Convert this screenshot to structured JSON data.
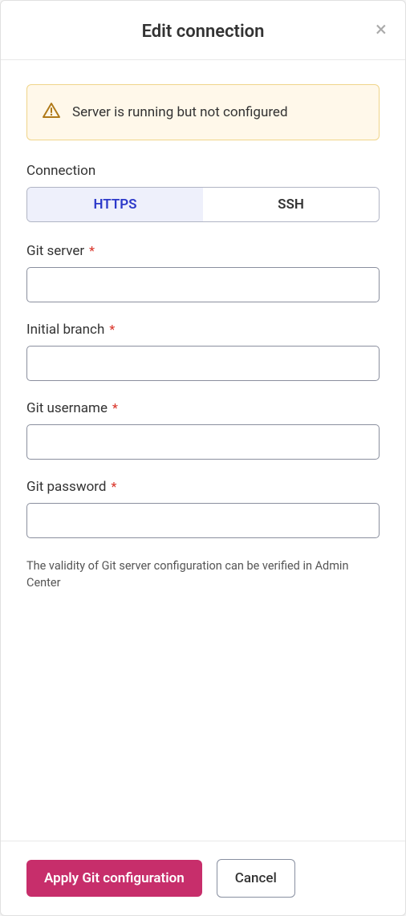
{
  "modal": {
    "title": "Edit connection"
  },
  "alert": {
    "message": "Server is running but not configured"
  },
  "form": {
    "connection_label": "Connection",
    "tabs": {
      "https": "HTTPS",
      "ssh": "SSH"
    },
    "fields": {
      "git_server": {
        "label": "Git server",
        "value": ""
      },
      "initial_branch": {
        "label": "Initial branch",
        "value": ""
      },
      "git_username": {
        "label": "Git username",
        "value": ""
      },
      "git_password": {
        "label": "Git password",
        "value": ""
      }
    },
    "helper": "The validity of Git server configuration can be verified in Admin Center"
  },
  "footer": {
    "apply": "Apply Git configuration",
    "cancel": "Cancel"
  }
}
